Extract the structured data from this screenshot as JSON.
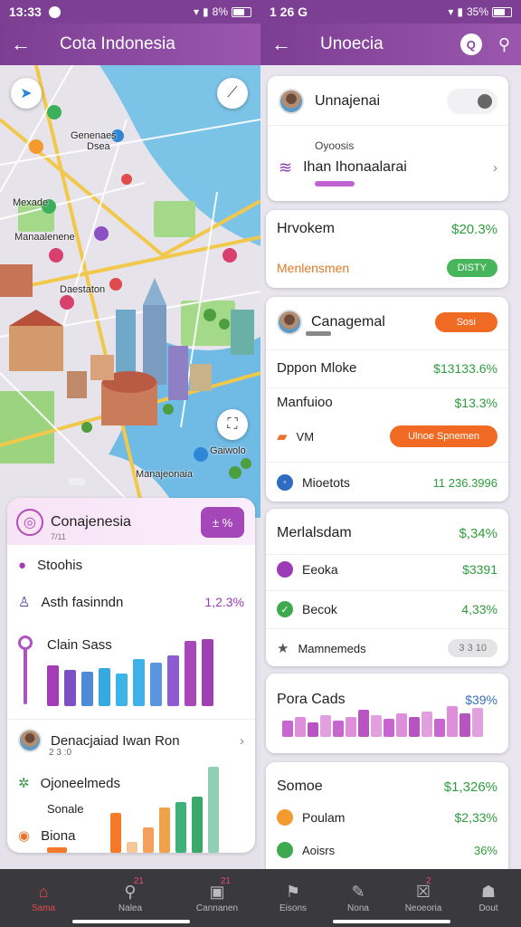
{
  "left": {
    "status": {
      "time": "13:33",
      "battery": "8%"
    },
    "appbar": {
      "title": "Cota Indonesia"
    },
    "map": {
      "labels": [
        "Genenaes",
        "Dsea",
        "Mexade",
        "Manaalenene",
        "Daestaton",
        "Manajeonaia",
        "Gaiwolo"
      ]
    },
    "panel": {
      "title": "Conajenesia",
      "subtitle": "7/11",
      "chip": "± %",
      "rows": {
        "r1": "Stoohis",
        "r2": "Asth fasinndn",
        "r2_value": "1,2.3%",
        "chart1_label": "Clain Sass",
        "person": "Denacjaiad Iwan Ron",
        "person_sub": "2 3 :0",
        "r4": "Ojoneelmeds",
        "r5": "Sonale",
        "r6": "Biona"
      },
      "chart1": {
        "values": [
          45,
          40,
          38,
          42,
          36,
          52,
          48,
          56,
          72,
          74
        ],
        "colors": [
          "#a43db5",
          "#7d4fc5",
          "#4d8ad8",
          "#36a9e0",
          "#3bb5e6",
          "#3fb0e8",
          "#5a95e0",
          "#8c5cd0",
          "#a847b8",
          "#9e40b2"
        ]
      },
      "chart2": {
        "values": [
          0,
          44,
          12,
          28,
          50,
          56,
          62,
          95
        ],
        "colors": [
          "#ffffff",
          "#f47a2a",
          "#f4c89a",
          "#f4a05a",
          "#f0a24a",
          "#3fb27a",
          "#3aa868",
          "#8fd0b5"
        ]
      }
    },
    "nav": [
      {
        "label": "Sama",
        "icon": "home-icon",
        "badge": ""
      },
      {
        "label": "Nalea",
        "icon": "search-icon",
        "badge": "21"
      },
      {
        "label": "Cannanen",
        "icon": "image-icon",
        "badge": "21"
      }
    ]
  },
  "right": {
    "status": {
      "time": "1 26 G",
      "battery": "35%"
    },
    "appbar": {
      "title": "Unoecia"
    },
    "card1": {
      "name": "Unnajenai",
      "sub_label": "Oyoosis",
      "item": "Ihan Ihonaalarai"
    },
    "card2": {
      "title": "Hrvokem",
      "value": "$20.3%",
      "sub": "Menlensmen",
      "pill": "DISTY"
    },
    "card3": {
      "name": "Canagemal",
      "pill": "Sosi",
      "rows": [
        {
          "label": "Dppon Mloke",
          "value": "$13133.6%"
        },
        {
          "label": "Manfuioo",
          "value": "$13.3%"
        },
        {
          "label": "VM",
          "pill": "Ulnoe Spnemen"
        },
        {
          "label": "Mioetots",
          "value": "11 236.3996"
        }
      ]
    },
    "card4": {
      "title": "Merlalsdam",
      "value": "$,34%",
      "rows": [
        {
          "label": "Eeoka",
          "value": "$3391"
        },
        {
          "label": "Becok",
          "value": "4,33%"
        },
        {
          "label": "Mamnemeds",
          "pill": "3 3 10"
        }
      ]
    },
    "card5": {
      "title": "Pora Cads",
      "value": "$39%",
      "bars": [
        18,
        22,
        16,
        24,
        18,
        22,
        30,
        24,
        20,
        26,
        22,
        28,
        20,
        34,
        26,
        32
      ]
    },
    "card6": {
      "title": "Somoe",
      "value": "$1,326%",
      "rows": [
        {
          "label": "Poulam",
          "value": "$2,33%"
        },
        {
          "label": "Aoisrs",
          "value": "36%"
        }
      ]
    },
    "nav": [
      {
        "label": "Eisons",
        "icon": "bookmark-icon",
        "badge": ""
      },
      {
        "label": "Nona",
        "icon": "tag-icon",
        "badge": ""
      },
      {
        "label": "Neoeoria",
        "icon": "close-box-icon",
        "badge": "2"
      },
      {
        "label": "Dout",
        "icon": "profile-icon",
        "badge": ""
      }
    ]
  }
}
